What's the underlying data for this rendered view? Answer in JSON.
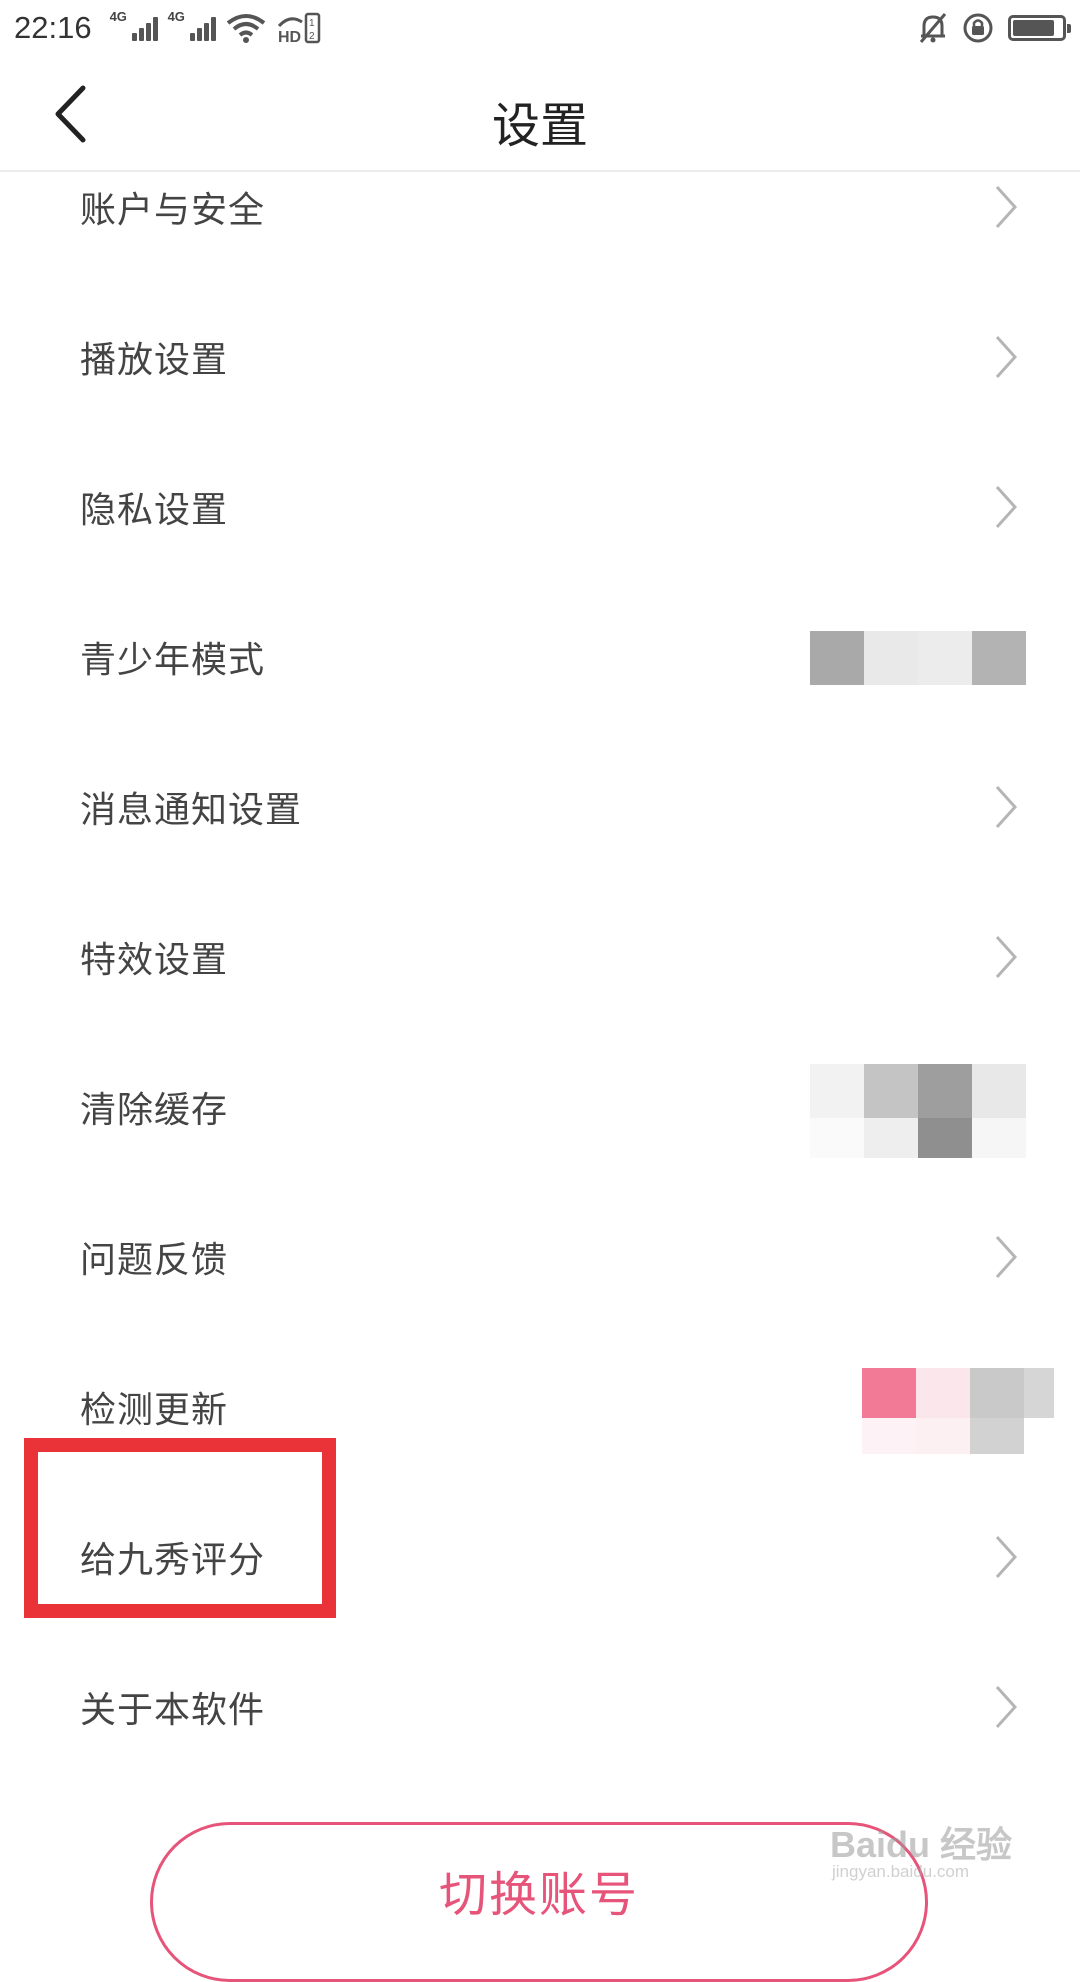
{
  "status_bar": {
    "time": "22:16",
    "network_1": "4G",
    "network_2": "4G",
    "icons": [
      "signal-icon",
      "signal-icon",
      "wifi-icon",
      "hd-icon",
      "mute-icon",
      "rotation-lock-icon",
      "battery-icon"
    ],
    "battery_level": 0.85
  },
  "header": {
    "title": "设置",
    "back_icon": "chevron-left-icon"
  },
  "settings": {
    "items": [
      {
        "label": "账户与安全",
        "trailing": "chevron"
      },
      {
        "label": "播放设置",
        "trailing": "chevron"
      },
      {
        "label": "隐私设置",
        "trailing": "chevron"
      },
      {
        "label": "青少年模式",
        "trailing": "pixelated"
      },
      {
        "label": "消息通知设置",
        "trailing": "chevron"
      },
      {
        "label": "特效设置",
        "trailing": "chevron"
      },
      {
        "label": "清除缓存",
        "trailing": "pixelated"
      },
      {
        "label": "问题反馈",
        "trailing": "chevron"
      },
      {
        "label": "检测更新",
        "trailing": "pixelated"
      },
      {
        "label": "给九秀评分",
        "trailing": "chevron"
      },
      {
        "label": "关于本软件",
        "trailing": "chevron"
      }
    ]
  },
  "switch_account": {
    "label": "切换账号"
  },
  "watermark": {
    "text": "Baidu 经验",
    "sub": "jingyan.baidu.com"
  },
  "colors": {
    "accent": "#e7547a",
    "highlight": "#ea3338",
    "text": "#444444",
    "chevron": "#b5b5b5"
  }
}
